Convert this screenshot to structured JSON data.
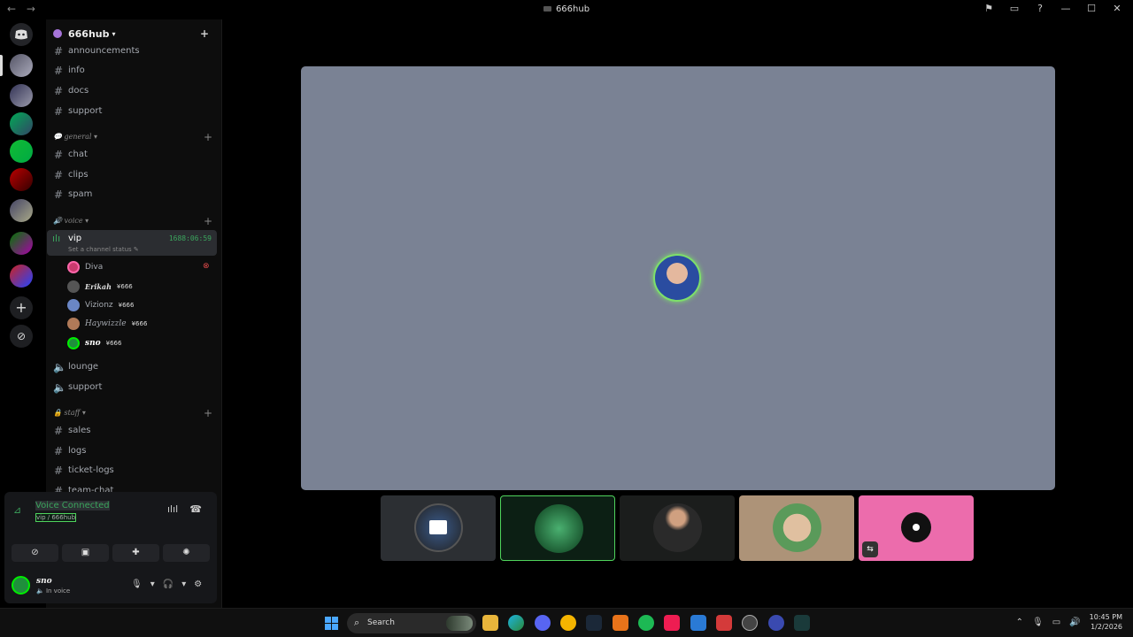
{
  "window": {
    "title": "666hub",
    "back": "←",
    "forward": "→"
  },
  "titlebar_icons": [
    "flag-icon",
    "inbox-icon",
    "help-icon",
    "minimize-icon",
    "maximize-icon",
    "close-icon"
  ],
  "titlebar_glyphs": {
    "flag": "⚑",
    "inbox": "▭",
    "help": "?",
    "min": "—",
    "max": "☐",
    "close": "✕"
  },
  "server": {
    "name": "666hub",
    "invite_glyph": "+"
  },
  "channels_top": [
    {
      "name": "announcements"
    },
    {
      "name": "info"
    },
    {
      "name": "docs"
    },
    {
      "name": "support"
    }
  ],
  "categories": {
    "general": "general",
    "voice": "voice",
    "staff": "staff"
  },
  "general_channels": [
    {
      "name": "chat"
    },
    {
      "name": "clips"
    },
    {
      "name": "spam"
    }
  ],
  "voice": {
    "active": {
      "name": "vip",
      "timer": "1688:06:59",
      "status": "Set a channel status"
    },
    "members": [
      {
        "name": "Diva",
        "tag": "",
        "color": "#c93a6e"
      },
      {
        "name": "Erikah",
        "tag": "¥666",
        "color": "#555555"
      },
      {
        "name": "Vizionz",
        "tag": "¥666",
        "color": "#6a86c5"
      },
      {
        "name": "Haywizzle",
        "tag": "¥666",
        "color": "#b07a58"
      },
      {
        "name": "sno",
        "tag": "¥666",
        "color": "#1f8f3c"
      }
    ],
    "others": [
      {
        "name": "lounge"
      },
      {
        "name": "support"
      }
    ]
  },
  "staff_channels": [
    {
      "name": "sales"
    },
    {
      "name": "logs"
    },
    {
      "name": "ticket-logs"
    },
    {
      "name": "team-chat"
    }
  ],
  "voice_panel": {
    "title": "Voice Connected",
    "subtitle": "vip / 666hub"
  },
  "user": {
    "name": "sno",
    "status": "In voice"
  },
  "taskbar": {
    "search_placeholder": "Search",
    "time": "10:45 PM",
    "date": "1/2/2026"
  },
  "colors": {
    "accent_green": "#3ba55d",
    "tile_gray": "#7a8294",
    "pink": "#ec6cac"
  }
}
